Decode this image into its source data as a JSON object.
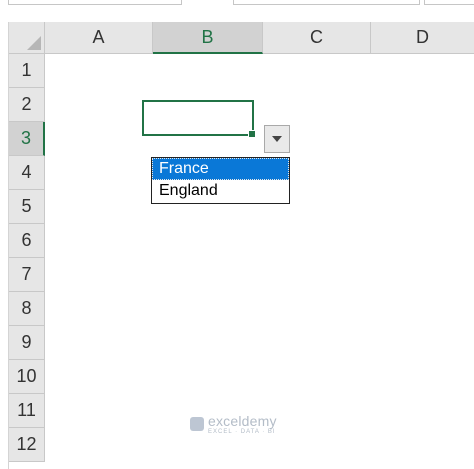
{
  "sheet": {
    "columns": [
      "A",
      "B",
      "C",
      "D"
    ],
    "rows": [
      "1",
      "2",
      "3",
      "4",
      "5",
      "6",
      "7",
      "8",
      "9",
      "10",
      "11",
      "12"
    ],
    "selected_column": "B",
    "selected_row": "3"
  },
  "dropdown": {
    "options": [
      "France",
      "England"
    ],
    "highlighted": "France"
  },
  "watermark": {
    "name": "exceldemy",
    "tagline": "EXCEL · DATA · BI"
  },
  "colors": {
    "accent": "#217346",
    "highlight": "#0a78d7"
  }
}
